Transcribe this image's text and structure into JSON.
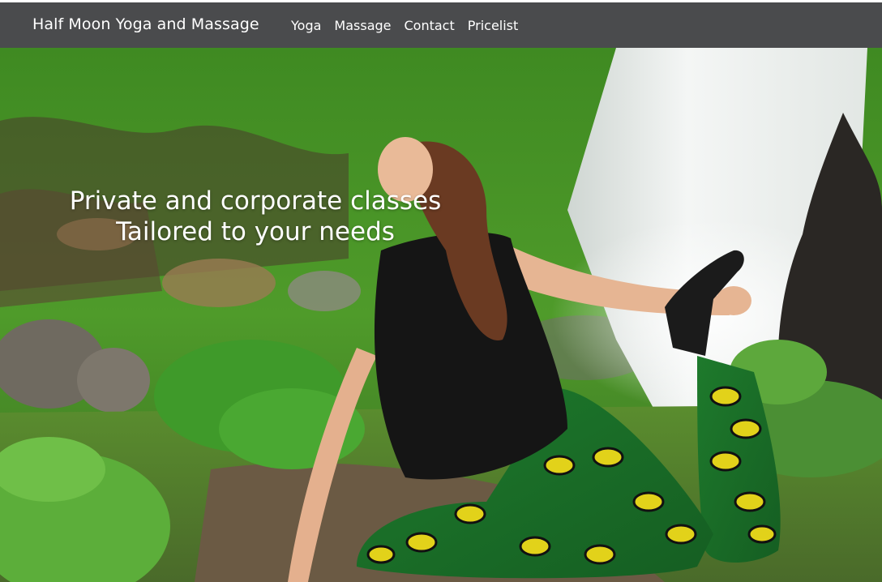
{
  "brand": {
    "name": "Half Moon Yoga and Massage"
  },
  "nav": {
    "items": [
      {
        "label": "Yoga"
      },
      {
        "label": "Massage"
      },
      {
        "label": "Contact"
      },
      {
        "label": "Pricelist"
      }
    ]
  },
  "hero": {
    "heading_line1": "Private and corporate classes",
    "heading_line2": "Tailored to your needs",
    "photo_subject": "woman doing a yoga stretch in front of a waterfall"
  },
  "colors": {
    "navbar_bg": "#4a4b4d",
    "nav_text": "#ffffff",
    "hero_text": "#ffffff"
  }
}
